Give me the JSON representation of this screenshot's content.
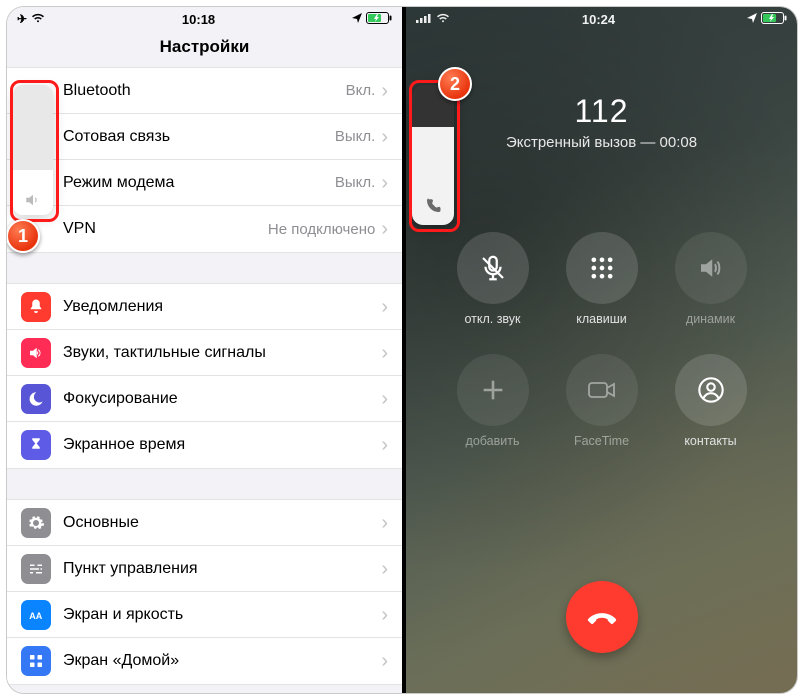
{
  "left": {
    "statusbar": {
      "time": "10:18"
    },
    "title": "Настройки",
    "group1": [
      {
        "label": "Bluetooth",
        "value": "Вкл."
      },
      {
        "label": "Сотовая связь",
        "value": "Выкл."
      },
      {
        "label": "Режим модема",
        "value": "Выкл."
      },
      {
        "label": "VPN",
        "value": "Не подключено"
      }
    ],
    "group2": [
      {
        "label": "Уведомления"
      },
      {
        "label": "Звуки, тактильные сигналы"
      },
      {
        "label": "Фокусирование"
      },
      {
        "label": "Экранное время"
      }
    ],
    "group3": [
      {
        "label": "Основные"
      },
      {
        "label": "Пункт управления"
      },
      {
        "label": "Экран и яркость"
      },
      {
        "label": "Экран «Домой»"
      }
    ],
    "volume": {
      "level_pct": 35
    },
    "badge": "1"
  },
  "right": {
    "statusbar": {
      "time": "10:24"
    },
    "call": {
      "number": "112",
      "subtitle": "Экстренный вызов — 00:08"
    },
    "buttons": {
      "mute": "откл. звук",
      "keypad": "клавиши",
      "speaker": "динамик",
      "add": "добавить",
      "facetime": "FaceTime",
      "contacts": "контакты"
    },
    "volume": {
      "level_pct": 70
    },
    "badge": "2"
  }
}
